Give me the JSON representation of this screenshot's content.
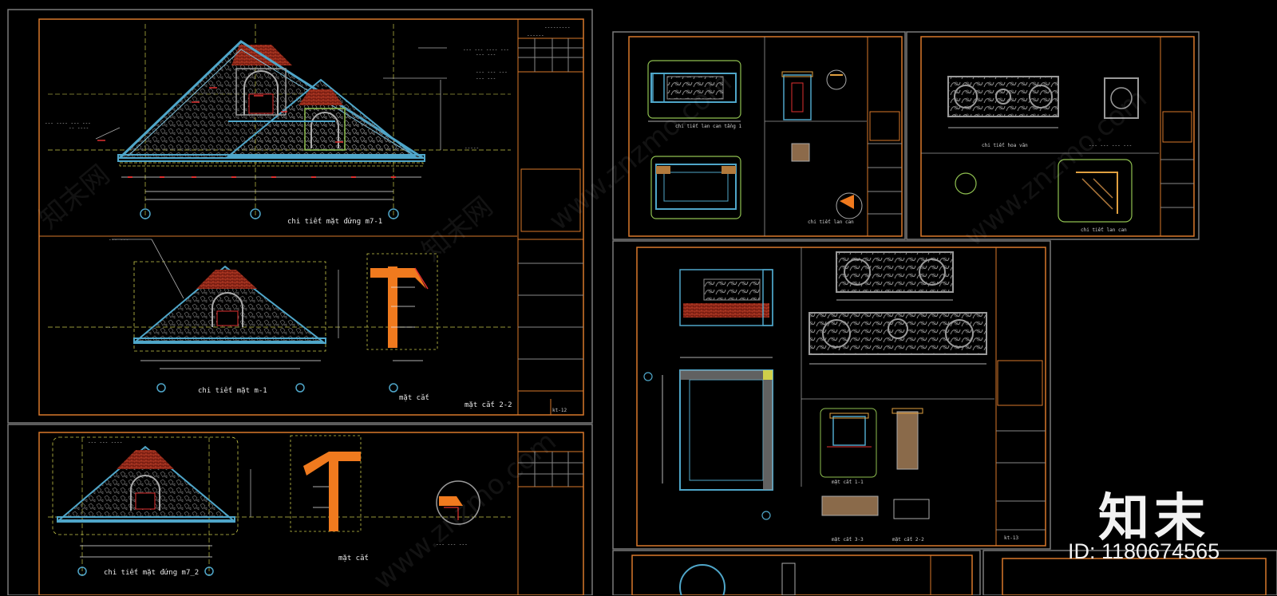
{
  "colors": {
    "background": "#000000",
    "sheet_border": "#d9782a",
    "sheet_frame": "#8a8a8a",
    "roof_tiles": "#b8402a",
    "outline_cyan": "#4fa6c9",
    "dashed_yellow": "#c8c84a",
    "dim_red": "#e03030",
    "section_orange": "#f07a1e",
    "relief_grey": "#8c8c8c",
    "dim_white": "#e8e8e8"
  },
  "drawing_labels": {
    "top_gable_elevation": "chi tiết mặt đứng m7-1",
    "mid_gable_elevation": "chi tiết mặt m-1",
    "mid_section": "mặt cắt",
    "section_2_2": "mặt cắt 2-2",
    "sheet_code_top": "kt-12",
    "bottom_gable_elevation": "chi tiết mặt đứng m7_2",
    "bottom_section": "mặt cắt",
    "r1_label_a": "chi tiết lan can tầng 1",
    "r1_label_b": "chi tiết lan can",
    "r2_label_a": "chi tiết hoa văn",
    "r2_label_b": "chi tiết lan can",
    "r3_section_1": "mặt cắt 1-1",
    "r3_section_3": "mặt cắt 3-3",
    "r3_section_2": "mặt cắt 2-2",
    "r3_sheet_code": "kt-13"
  },
  "watermark": {
    "brand": "知末",
    "id_text": "ID: 1180674565",
    "site": "www.znzmo.com",
    "site_cn": "知末网"
  },
  "icons": [
    "section-marker-icon",
    "axis-bubble-icon",
    "ornament-scroll-icon"
  ]
}
